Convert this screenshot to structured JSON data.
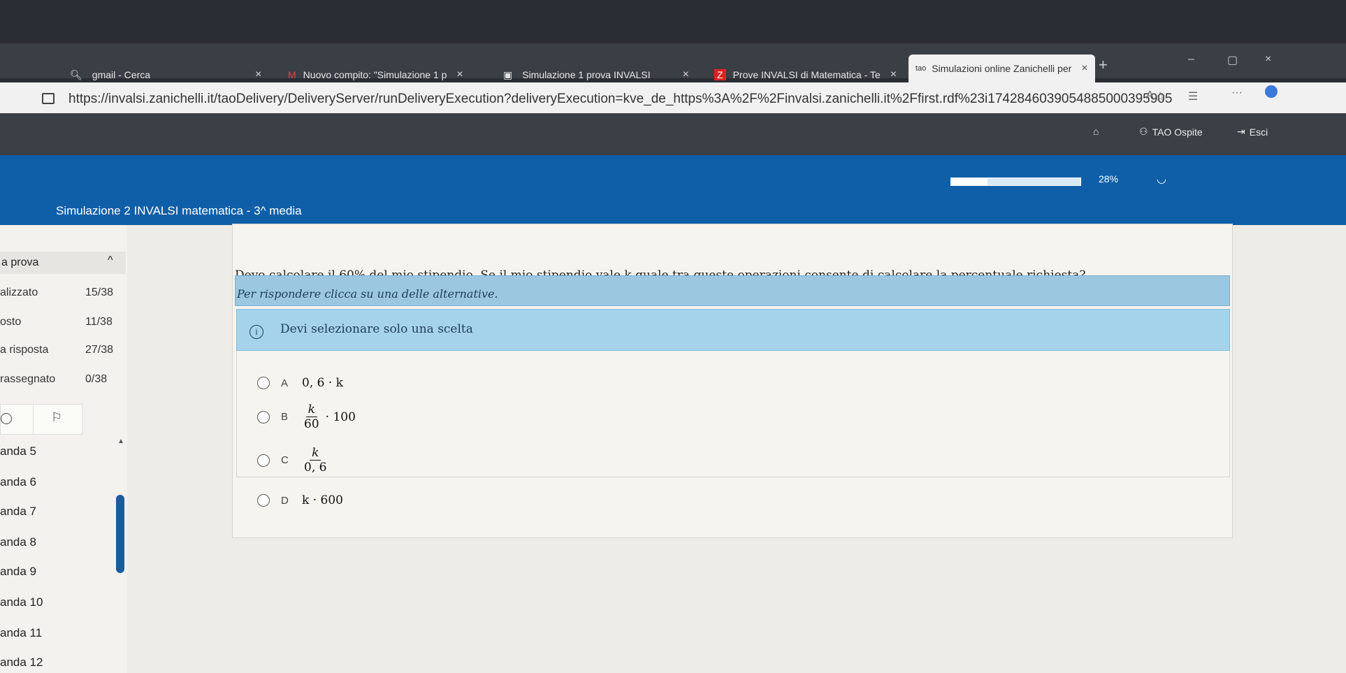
{
  "browser": {
    "tabs": [
      {
        "label": "gmail - Cerca"
      },
      {
        "label": "Nuovo compito: \"Simulazione 1 p"
      },
      {
        "label": "Simulazione 1 prova INVALSI"
      },
      {
        "label": "Prove INVALSI di Matematica - Te"
      },
      {
        "label": "Simulazioni online Zanichelli per"
      }
    ],
    "url": "https://invalsi.zanichelli.it/taoDelivery/DeliveryServer/runDeliveryExecution?deliveryExecution=kve_de_https%3A%2F%2Finvalsi.zanichelli.it%2Ffirst.rdf%23i17428460390548850003959​05"
  },
  "header": {
    "user_label": "TAO Ospite",
    "exit_label": "Esci"
  },
  "test": {
    "title": "Simulazione 2 INVALSI matematica - 3^ media",
    "progress_percent": 28,
    "progress_label": "28%"
  },
  "sidebar": {
    "section_title": "a prova",
    "stats": [
      {
        "label": "alizzato",
        "value": "15/38"
      },
      {
        "label": "osto",
        "value": "11/38"
      },
      {
        "label": "a risposta",
        "value": "27/38"
      },
      {
        "label": "rassegnato",
        "value": "0/38"
      }
    ],
    "items": [
      "anda 5",
      "anda 6",
      "anda 7",
      "anda 8",
      "anda 9",
      "anda 10",
      "anda 11",
      "anda 12"
    ]
  },
  "question": {
    "text": "Devo calcolare il 60% del mio stipendio. Se il mio stipendio vale k quale tra queste operazioni consente di calcolare la percentuale richiesta?",
    "instruction": "Per rispondere clicca su una delle alternative.",
    "info": "Devi selezionare solo una scelta",
    "choices": [
      {
        "letter": "A",
        "expr": "0, 6 · k"
      },
      {
        "letter": "B",
        "num": "k",
        "den": "60",
        "tail": "· 100"
      },
      {
        "letter": "C",
        "num": "k",
        "den": "0, 6"
      },
      {
        "letter": "D",
        "expr": "k · 600"
      }
    ]
  }
}
